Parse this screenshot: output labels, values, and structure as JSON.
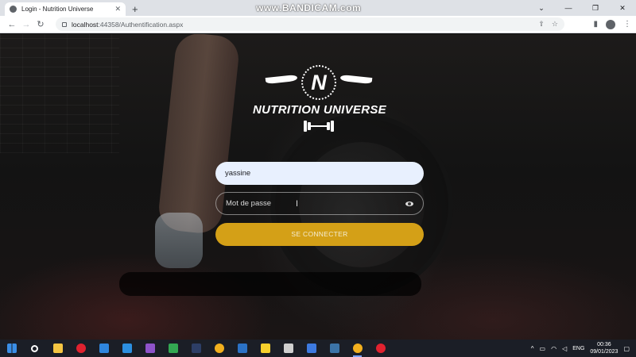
{
  "browser": {
    "tab_title": "Login - Nutrition Universe",
    "tab_close": "✕",
    "new_tab": "+",
    "url_host": "localhost",
    "url_rest": ":44358/Authentification.aspx",
    "watermark": "www.BANDICAM.com",
    "window_controls": [
      "⌄",
      "—",
      "❐",
      "✕"
    ],
    "nav": {
      "back": "←",
      "forward": "→",
      "reload": "↻"
    },
    "omnibox_icons": [
      "⇪",
      "☆"
    ],
    "toolbar_icons": [
      "▮",
      "⋮"
    ]
  },
  "page": {
    "logo_letter": "N",
    "brand_name": "NUTRITION UNIVERSE",
    "username_value": "yassine",
    "password_placeholder": "Mot de passe",
    "text_cursor": "I",
    "submit_label": "SE CONNECTER"
  },
  "taskbar": {
    "apps": [
      {
        "name": "windows-start",
        "color": "#3a8ee6"
      },
      {
        "name": "search",
        "color": "#ffffff"
      },
      {
        "name": "file-explorer",
        "color": "#f4c542"
      },
      {
        "name": "opera",
        "color": "#e0222f"
      },
      {
        "name": "mail",
        "color": "#2f86de"
      },
      {
        "name": "vscode",
        "color": "#2c8fe0"
      },
      {
        "name": "visual-studio",
        "color": "#8e53c9"
      },
      {
        "name": "app-green",
        "color": "#33a852"
      },
      {
        "name": "app-dark",
        "color": "#2d3e66"
      },
      {
        "name": "chrome",
        "color": "#f2b01e"
      },
      {
        "name": "word-app",
        "color": "#2b72c6"
      },
      {
        "name": "sticky-notes",
        "color": "#f7d02c"
      },
      {
        "name": "store",
        "color": "#cfcfcf"
      },
      {
        "name": "app-blue",
        "color": "#3d7ae0"
      },
      {
        "name": "python",
        "color": "#3c74a8"
      },
      {
        "name": "chrome-active",
        "color": "#f2b01e"
      },
      {
        "name": "recorder",
        "color": "#e0222f"
      }
    ],
    "tray_chevron": "^",
    "language": "ENG",
    "time": "00:36",
    "date": "09/01/2023"
  }
}
